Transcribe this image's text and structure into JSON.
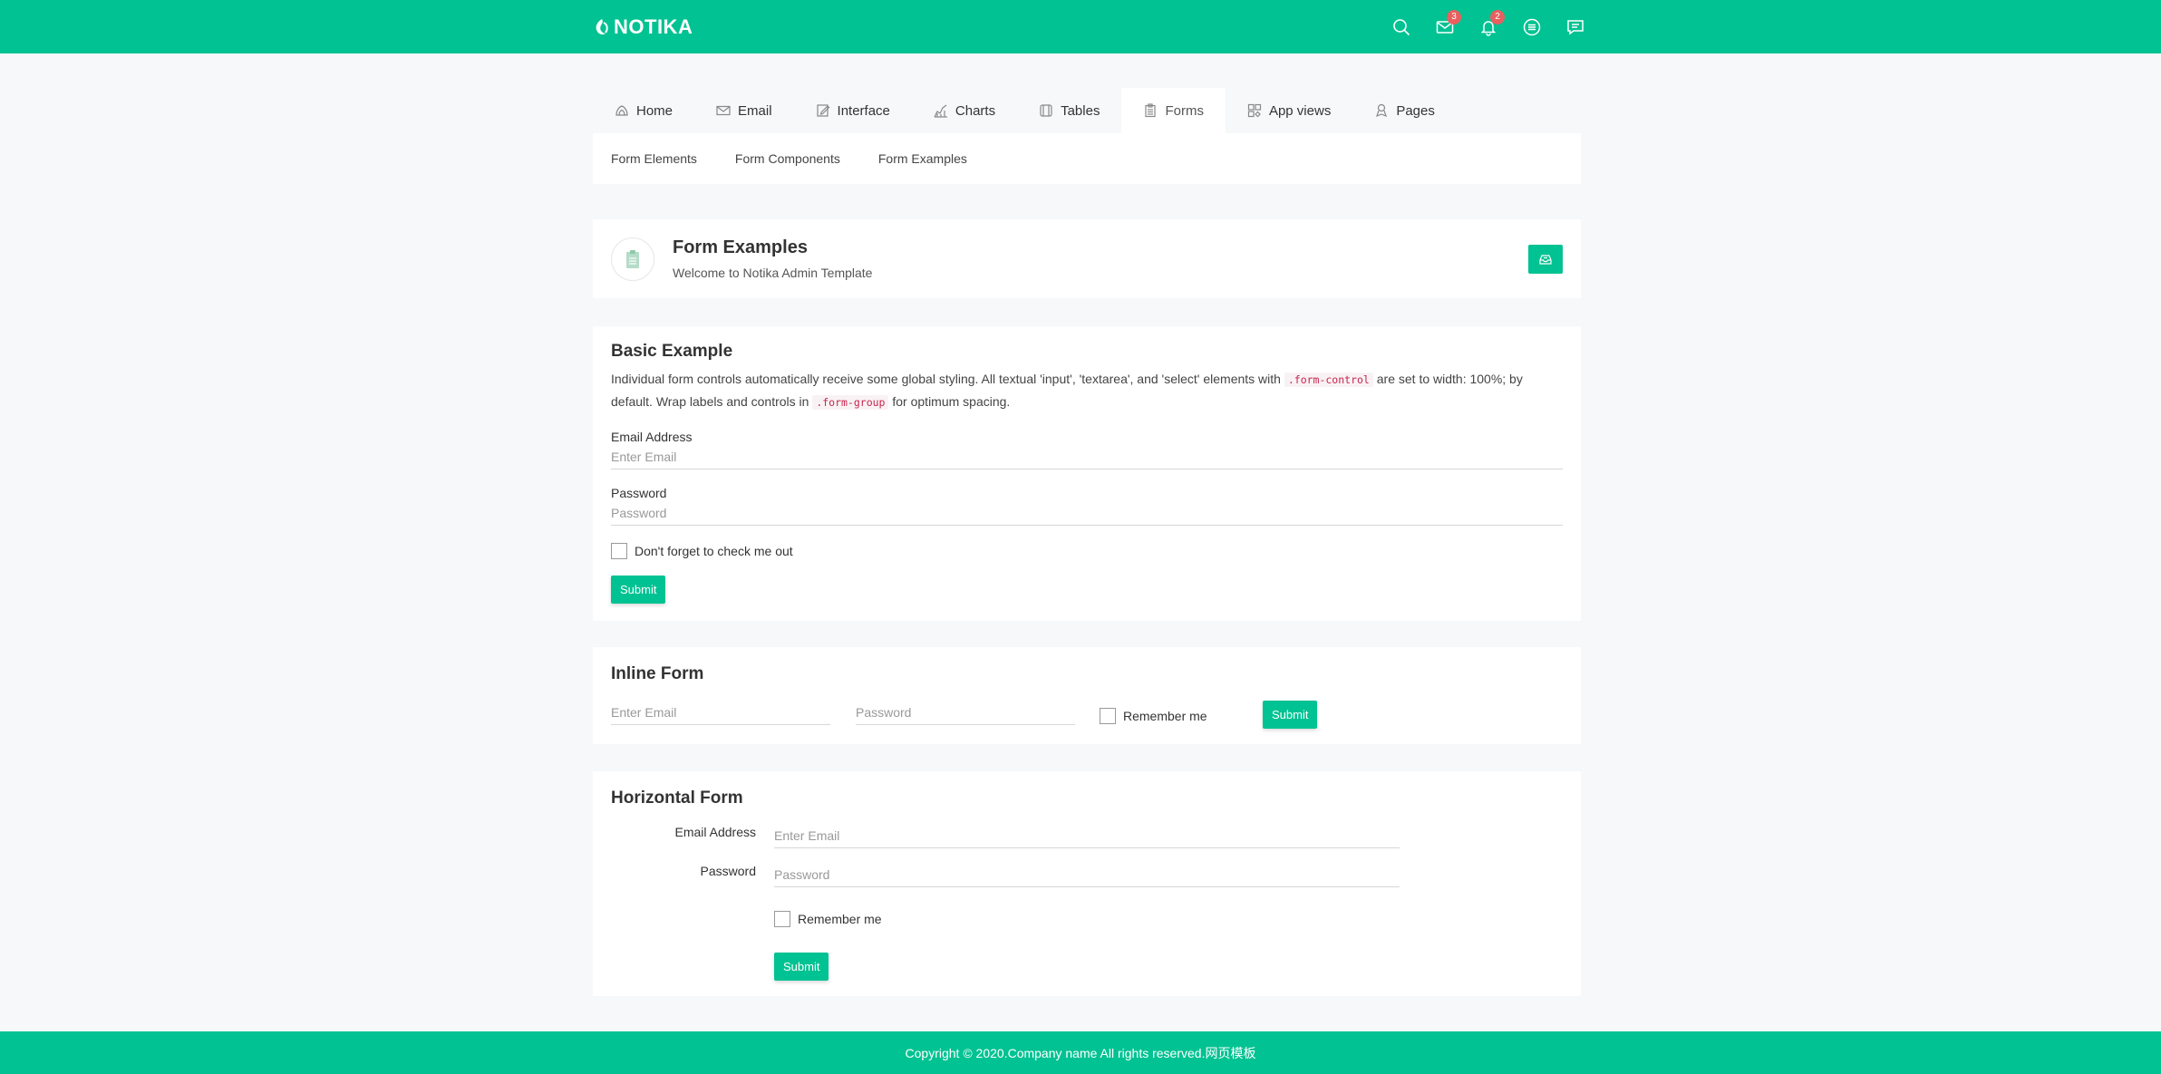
{
  "brand": {
    "name": "NOTIKA"
  },
  "colors": {
    "accent": "#00c292",
    "badge": "#e85f5f",
    "page_bg": "#f6f8fa"
  },
  "header_icons": [
    {
      "icon": "search-icon",
      "badge": ""
    },
    {
      "icon": "mail-icon",
      "badge": "3"
    },
    {
      "icon": "bell-icon",
      "badge": "2"
    },
    {
      "icon": "menu-icon",
      "badge": ""
    },
    {
      "icon": "chat-icon",
      "badge": ""
    }
  ],
  "nav": {
    "tabs": [
      {
        "label": "Home",
        "icon": "home-icon"
      },
      {
        "label": "Email",
        "icon": "mail-icon"
      },
      {
        "label": "Interface",
        "icon": "edit-icon"
      },
      {
        "label": "Charts",
        "icon": "chart-icon"
      },
      {
        "label": "Tables",
        "icon": "table-icon"
      },
      {
        "label": "Forms",
        "icon": "form-icon",
        "active": true
      },
      {
        "label": "App views",
        "icon": "app-views-icon"
      },
      {
        "label": "Pages",
        "icon": "pages-icon"
      }
    ],
    "sub_links": [
      "Form Elements",
      "Form Components",
      "Form Examples"
    ]
  },
  "breadcrumb": {
    "title": "Form Examples",
    "subtitle": "Welcome to Notika Admin Template",
    "icon": "clipboard-icon",
    "button_icon": "inbox-icon"
  },
  "basic": {
    "title": "Basic Example",
    "desc_1": "Individual form controls automatically receive some global styling. All textual 'input', 'textarea', and 'select' elements with",
    "code_1": ".form-control",
    "desc_2": "are set to width: 100%; by default. Wrap labels and controls in",
    "code_2": ".form-group",
    "desc_3": "for optimum spacing.",
    "email_label": "Email Address",
    "email_placeholder": "Enter Email",
    "password_label": "Password",
    "password_placeholder": "Password",
    "checkbox_label": "Don't forget to check me out",
    "submit_label": "Submit"
  },
  "inline": {
    "title": "Inline Form",
    "email_placeholder": "Enter Email",
    "password_placeholder": "Password",
    "checkbox_label": "Remember me",
    "submit_label": "Submit"
  },
  "horizontal": {
    "title": "Horizontal Form",
    "email_label": "Email Address",
    "email_placeholder": "Enter Email",
    "password_label": "Password",
    "password_placeholder": "Password",
    "checkbox_label": "Remember me",
    "submit_label": "Submit"
  },
  "footer": {
    "text": "Copyright © 2020.Company name All rights reserved.网页模板"
  }
}
